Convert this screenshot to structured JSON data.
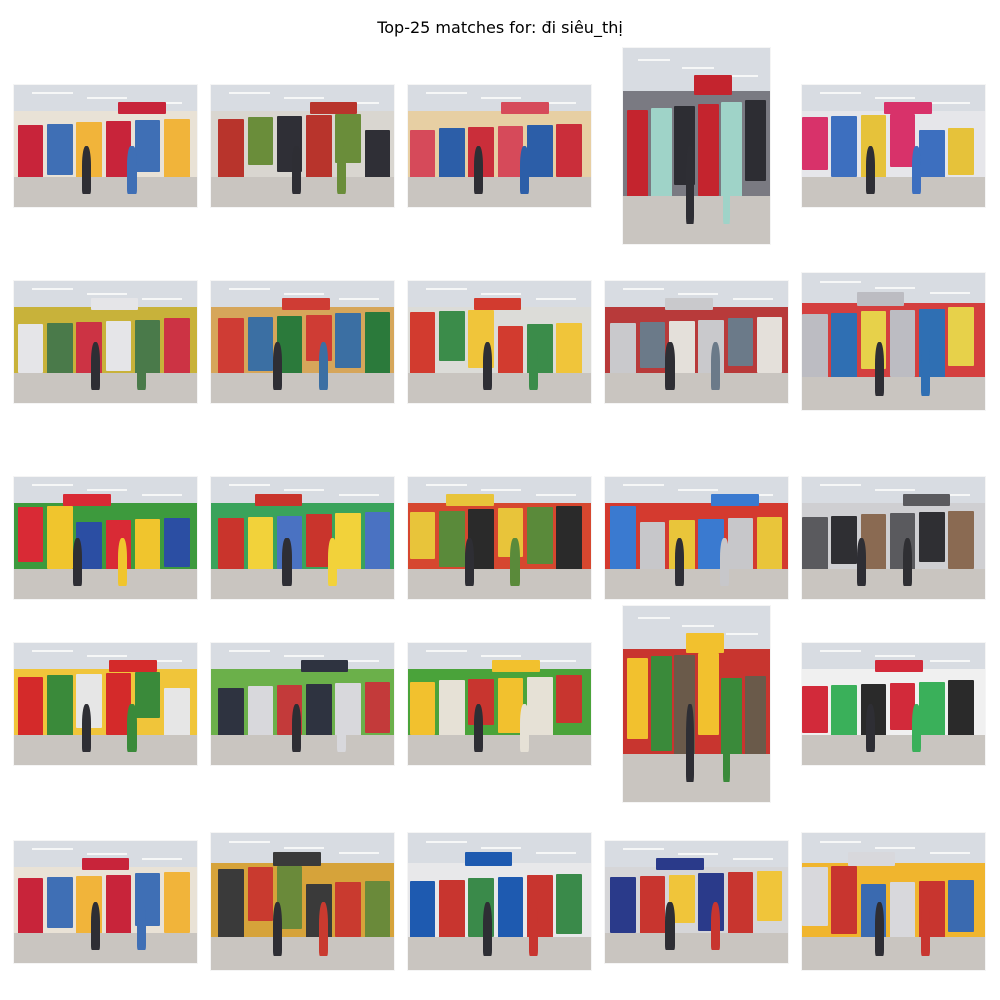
{
  "title": "Top-25 matches for: đi siêu_thị",
  "results": [
    {
      "rank": 1,
      "aspect": "wide",
      "palette": [
        "#c8243a",
        "#e9e2d6",
        "#3f6fb5",
        "#f1b43a"
      ]
    },
    {
      "rank": 2,
      "aspect": "wide",
      "palette": [
        "#b8342c",
        "#d9d6d0",
        "#6a8d3a",
        "#2f2f36"
      ]
    },
    {
      "rank": 3,
      "aspect": "wide",
      "palette": [
        "#d64a5a",
        "#e7cfa3",
        "#2c5ea8",
        "#ca2e3a"
      ]
    },
    {
      "rank": 4,
      "aspect": "tall",
      "palette": [
        "#c4242e",
        "#7a7a82",
        "#9fd3c8",
        "#2d2d33"
      ]
    },
    {
      "rank": 5,
      "aspect": "wide",
      "palette": [
        "#d8326a",
        "#e6e6ea",
        "#3d6fbf",
        "#e6c23a"
      ]
    },
    {
      "rank": 6,
      "aspect": "wide",
      "palette": [
        "#e5e5e8",
        "#c8b23a",
        "#4a7a4a",
        "#cc3344"
      ]
    },
    {
      "rank": 7,
      "aspect": "wide",
      "palette": [
        "#cf3c34",
        "#d6a65a",
        "#3b6fa3",
        "#2b7a3b"
      ]
    },
    {
      "rank": 8,
      "aspect": "wide",
      "palette": [
        "#d23b2f",
        "#dcdcd8",
        "#3b8c4a",
        "#f0c53a"
      ]
    },
    {
      "rank": 9,
      "aspect": "wide",
      "palette": [
        "#c9c9cc",
        "#b83a3a",
        "#6b7a89",
        "#e4e0da"
      ]
    },
    {
      "rank": 10,
      "aspect": "squarish",
      "palette": [
        "#bcbcc2",
        "#d43f3f",
        "#2f6fb3",
        "#e7d14a"
      ]
    },
    {
      "rank": 11,
      "aspect": "wide",
      "palette": [
        "#d92a35",
        "#3d9a3d",
        "#f0c52d",
        "#2b4ea3"
      ]
    },
    {
      "rank": 12,
      "aspect": "wide",
      "palette": [
        "#c9342c",
        "#3aa35b",
        "#f2d23a",
        "#4a72c2"
      ]
    },
    {
      "rank": 13,
      "aspect": "wide",
      "palette": [
        "#e8c43a",
        "#d6472f",
        "#5a8a3a",
        "#2a2a2a"
      ]
    },
    {
      "rank": 14,
      "aspect": "wide",
      "palette": [
        "#3a7ad0",
        "#d43a2f",
        "#c7c7ca",
        "#e9c53a"
      ]
    },
    {
      "rank": 15,
      "aspect": "wide",
      "palette": [
        "#5a5a5e",
        "#cfcfd2",
        "#2f2f33",
        "#8a6a52"
      ]
    },
    {
      "rank": 16,
      "aspect": "wide",
      "palette": [
        "#d42a2a",
        "#f0c53a",
        "#3a8a3a",
        "#e6e6e6"
      ]
    },
    {
      "rank": 17,
      "aspect": "wide",
      "palette": [
        "#2e3340",
        "#6bb04a",
        "#d8d8dc",
        "#c33a3a"
      ]
    },
    {
      "rank": 18,
      "aspect": "wide",
      "palette": [
        "#f2c12e",
        "#4aa33a",
        "#e6e1d6",
        "#c8352f"
      ]
    },
    {
      "rank": 19,
      "aspect": "tall",
      "palette": [
        "#f2c12e",
        "#c8352f",
        "#3a8a3a",
        "#6a5a4a"
      ]
    },
    {
      "rank": 20,
      "aspect": "wide",
      "palette": [
        "#d22a3a",
        "#f0f0f0",
        "#3ab05a",
        "#2a2a2a"
      ]
    },
    {
      "rank": 21,
      "aspect": "wide",
      "palette": [
        "#c8243a",
        "#e9e2d6",
        "#3f6fb5",
        "#f1b43a"
      ]
    },
    {
      "rank": 22,
      "aspect": "squarish",
      "palette": [
        "#3a3a3a",
        "#d6a33a",
        "#c93a2f",
        "#6a8a3a"
      ]
    },
    {
      "rank": 23,
      "aspect": "squarish",
      "palette": [
        "#1e5ab0",
        "#e8e8ea",
        "#c8352f",
        "#3a8a4a"
      ]
    },
    {
      "rank": 24,
      "aspect": "wide",
      "palette": [
        "#2a3a8a",
        "#d6d6d8",
        "#c8352f",
        "#f0c53a"
      ]
    },
    {
      "rank": 25,
      "aspect": "squarish",
      "palette": [
        "#d8d8dc",
        "#f0b52e",
        "#c8352f",
        "#3a6ab0"
      ]
    }
  ]
}
